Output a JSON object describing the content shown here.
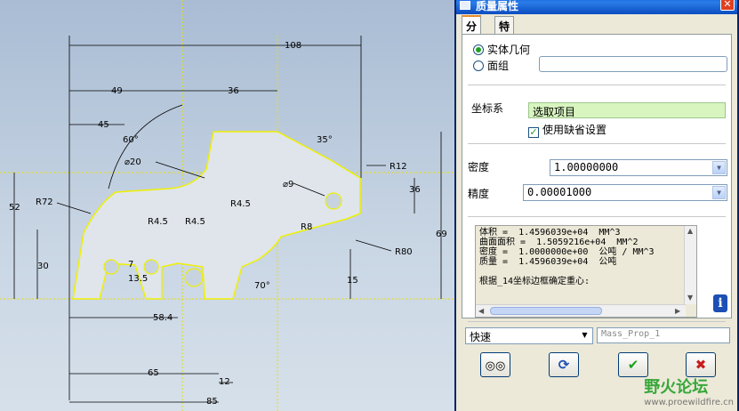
{
  "dialog": {
    "title": "质量属性",
    "tabs": [
      "分析",
      "特征"
    ],
    "source": {
      "option_solid": "实体几何",
      "option_quilt": "面组"
    },
    "coord_label": "坐标系",
    "coord_value": "选取项目",
    "default_settings": "使用缺省设置",
    "density_label": "密度",
    "density_value": "1.00000000",
    "precision_label": "精度",
    "precision_value": "0.00001000",
    "results": [
      "体积 =  1.4596039e+04  MM^3",
      "曲面面积 =  1.5059216e+04  MM^2",
      "密度 =  1.0000000e+00  公吨 / MM^3",
      "质量 =  1.4596039e+04  公吨",
      "",
      "根据_14坐标边框确定重心:"
    ],
    "mode_value": "快速",
    "name_value": "Mass_Prop_1",
    "info_icon": "i",
    "watermark": "野火论坛",
    "watermark_url": "www.proewildfire.cn"
  },
  "cad": {
    "dimensions": [
      "108",
      "49",
      "36",
      "45",
      "60°",
      "⌀20",
      "35°",
      "R12",
      "⌀9",
      "36",
      "52",
      "R72",
      "R4.5",
      "R4.5",
      "R4.5",
      "R8",
      "69",
      "30",
      "7",
      "13.5",
      "R80",
      "15",
      "70°",
      "58.4",
      "65",
      "12",
      "85"
    ]
  }
}
